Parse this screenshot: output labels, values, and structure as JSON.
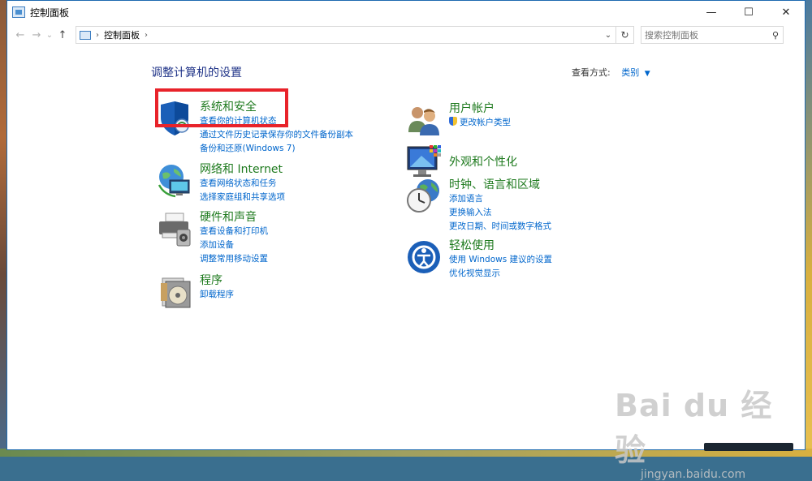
{
  "window": {
    "title": "控制面板",
    "controls": {
      "minimize": "—",
      "maximize": "☐",
      "close": "✕"
    }
  },
  "navigation": {
    "back": "←",
    "forward": "→",
    "recent": "⌄",
    "up": "↑",
    "breadcrumb": "控制面板",
    "separator": "›",
    "dropdown": "⌄",
    "refresh": "↻"
  },
  "search": {
    "placeholder": "搜索控制面板",
    "icon": "⚲"
  },
  "main": {
    "heading": "调整计算机的设置",
    "view_by_label": "查看方式:",
    "view_by_value": "类别",
    "view_by_caret": "▼"
  },
  "categories_left": [
    {
      "title": "系统和安全",
      "icon": "shield-icon",
      "links": [
        "查看你的计算机状态",
        "通过文件历史记录保存你的文件备份副本",
        "备份和还原(Windows 7)"
      ]
    },
    {
      "title": "网络和 Internet",
      "icon": "network-globe-icon",
      "links": [
        "查看网络状态和任务",
        "选择家庭组和共享选项"
      ]
    },
    {
      "title": "硬件和声音",
      "icon": "printer-speaker-icon",
      "links": [
        "查看设备和打印机",
        "添加设备",
        "调整常用移动设置"
      ]
    },
    {
      "title": "程序",
      "icon": "programs-disc-icon",
      "links": [
        "卸载程序"
      ]
    }
  ],
  "categories_right": [
    {
      "title": "用户帐户",
      "icon": "users-icon",
      "links": [
        "更改帐户类型"
      ]
    },
    {
      "title": "外观和个性化",
      "icon": "monitor-palette-icon",
      "links": []
    },
    {
      "title": "时钟、语言和区域",
      "icon": "clock-globe-icon",
      "links": [
        "添加语言",
        "更换输入法",
        "更改日期、时间或数字格式"
      ]
    },
    {
      "title": "轻松使用",
      "icon": "ease-of-access-icon",
      "links": [
        "使用 Windows 建议的设置",
        "优化视觉显示"
      ]
    }
  ],
  "watermark": {
    "brand": "Bai du 经验",
    "url": "jingyan.baidu.com"
  },
  "colors": {
    "category_title": "#1e7a1e",
    "link": "#0066cc",
    "heading": "#1e3287",
    "highlight": "#e8232a"
  }
}
